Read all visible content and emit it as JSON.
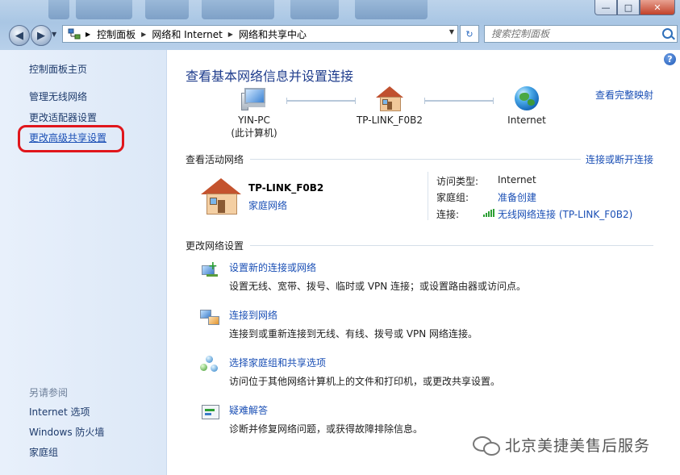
{
  "window": {
    "minimize_glyph": "—",
    "maximize_glyph": "□",
    "close_glyph": "✕"
  },
  "nav": {
    "back_glyph": "◀",
    "forward_glyph": "▶"
  },
  "address": {
    "breadcrumbs": [
      "控制面板",
      "网络和 Internet",
      "网络和共享中心"
    ]
  },
  "search": {
    "placeholder": "搜索控制面板"
  },
  "sidebar": {
    "home": "控制面板主页",
    "items": [
      "管理无线网络",
      "更改适配器设置",
      "更改高级共享设置"
    ],
    "see_also_label": "另请参阅",
    "see_also": [
      "Internet 选项",
      "Windows 防火墙",
      "家庭组"
    ]
  },
  "main": {
    "title": "查看基本网络信息并设置连接",
    "full_map_link": "查看完整映射",
    "map": {
      "computer_name": "YIN-PC",
      "computer_sub": "(此计算机)",
      "router_name": "TP-LINK_F0B2",
      "internet_name": "Internet"
    },
    "active_section_title": "查看活动网络",
    "connect_link": "连接或断开连接",
    "active_network": {
      "name": "TP-LINK_F0B2",
      "type": "家庭网络",
      "access_type_label": "访问类型:",
      "access_type_value": "Internet",
      "homegroup_label": "家庭组:",
      "homegroup_value": "准备创建",
      "connections_label": "连接:",
      "connections_value": "无线网络连接 (TP-LINK_F0B2)"
    },
    "change_section_title": "更改网络设置",
    "tasks": [
      {
        "title": "设置新的连接或网络",
        "desc": "设置无线、宽带、拨号、临时或 VPN 连接；或设置路由器或访问点。"
      },
      {
        "title": "连接到网络",
        "desc": "连接到或重新连接到无线、有线、拨号或 VPN 网络连接。"
      },
      {
        "title": "选择家庭组和共享选项",
        "desc": "访问位于其他网络计算机上的文件和打印机，或更改共享设置。"
      },
      {
        "title": "疑难解答",
        "desc": "诊断并修复网络问题，或获得故障排除信息。"
      }
    ]
  },
  "watermark": "北京美捷美售后服务",
  "colors": {
    "link": "#1a4fb5",
    "title": "#1e3c8c",
    "highlight_circle": "#e0161c",
    "sidebar_bg": "#e8f0fb"
  }
}
